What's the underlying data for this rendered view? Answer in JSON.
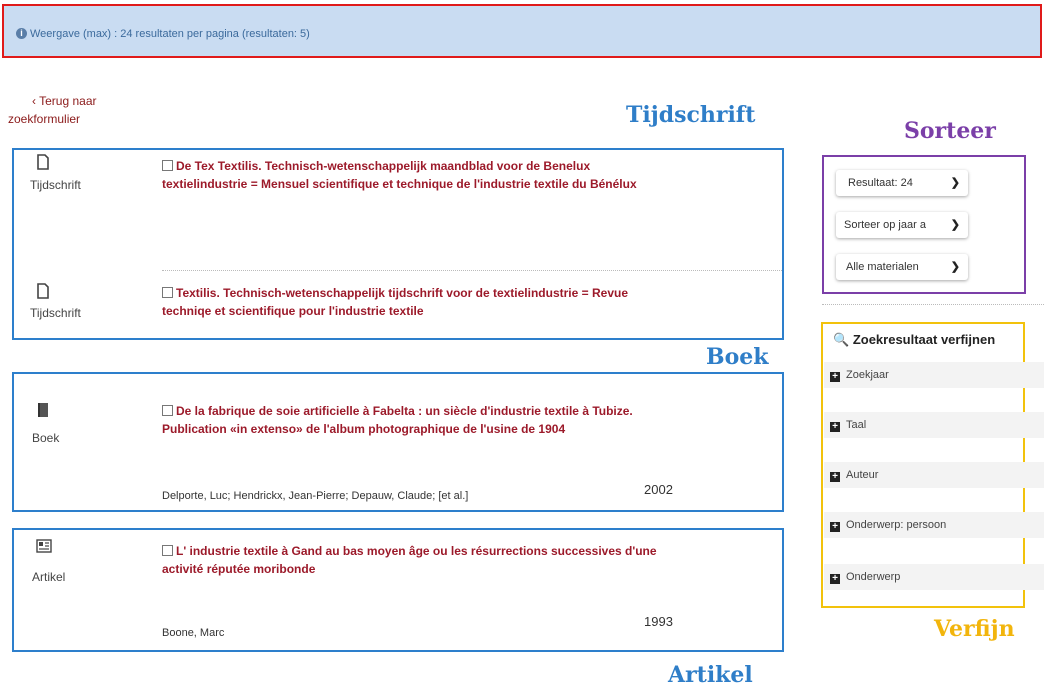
{
  "info": {
    "icon": "info-circle-icon",
    "text": "Weergave (max) : 24 resultaten per pagina (resultaten: 5)"
  },
  "back": {
    "line1": "‹  Terug naar",
    "line2": "zoekformulier"
  },
  "annotations": {
    "tijdschrift": "Tijdschrift",
    "boek": "Boek",
    "artikel": "Artikel",
    "sorteer": "Sorteer",
    "verfijn": "Verfijn"
  },
  "results": [
    {
      "type": "Tijdschrift",
      "icon": "document-icon",
      "title1": "De Tex Textilis. Technisch-wetenschappelijk maandblad voor de Benelux",
      "title2": "textielindustrie = Mensuel scientifique et technique de l'industrie textile du Bénélux"
    },
    {
      "type": "Tijdschrift",
      "icon": "document-icon",
      "title1": "Textilis. Technisch-wetenschappelijk tijdschrift voor de textielindustrie = Revue",
      "title2": "techniqe et scientifique pour l'industrie textile"
    },
    {
      "type": "Boek",
      "icon": "book-icon",
      "title1": "De la fabrique de soie artificielle à Fabelta : un siècle d'industrie textile à Tubize.",
      "title2": "Publication «in extenso» de l'album photographique de l'usine de 1904",
      "authors": "Delporte, Luc; Hendrickx, Jean-Pierre; Depauw, Claude; [et al.]",
      "year": "2002"
    },
    {
      "type": "Artikel",
      "icon": "newspaper-icon",
      "title1": "L' industrie textile à Gand au bas moyen âge ou les résurrections successives d'une",
      "title2": "activité réputée moribonde",
      "authors": "Boone, Marc",
      "year": "1993"
    }
  ],
  "sort": {
    "results": "Resultaat: 24",
    "order": "Sorteer op jaar a",
    "materials": "Alle materialen"
  },
  "refine": {
    "icon": "search-icon",
    "title": "Zoekresultaat verfijnen",
    "facets": [
      "Zoekjaar",
      "Taal",
      "Auteur",
      "Onderwerp: persoon",
      "Onderwerp"
    ]
  }
}
